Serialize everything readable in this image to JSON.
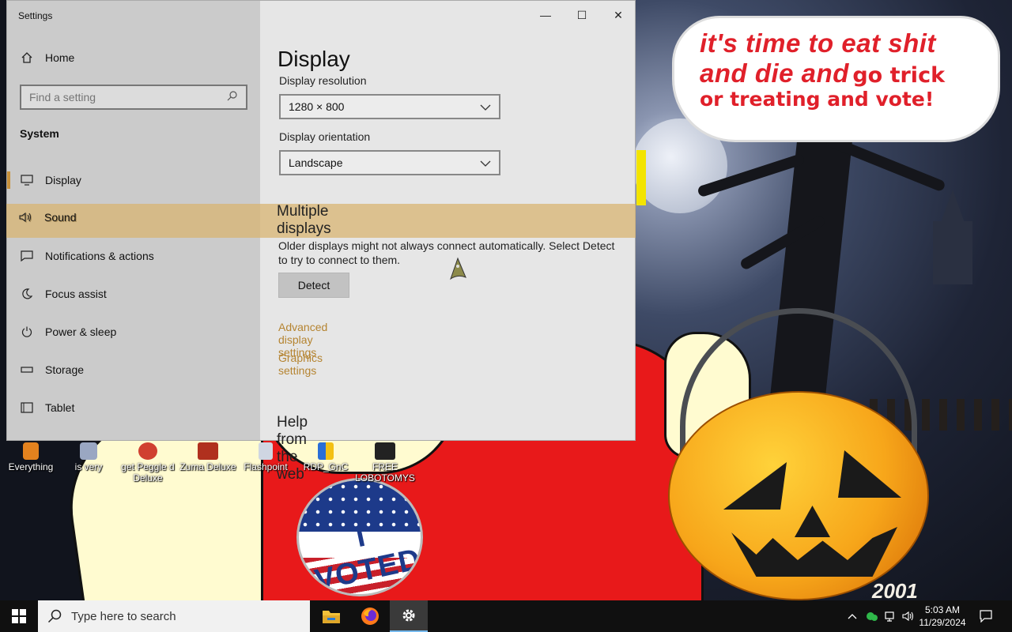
{
  "wallpaper": {
    "speech_line1": "it's time to eat shit",
    "speech_line2a": "and die and",
    "speech_line2b": "go trick",
    "speech_line3": "or treating and vote!",
    "badge_text": "I VOTED",
    "year_mark": "2001"
  },
  "desktop_icons": [
    {
      "label": "Everything"
    },
    {
      "label": "is very"
    },
    {
      "label": "get Peggle d Deluxe"
    },
    {
      "label": "Zuma Deluxe"
    },
    {
      "label": "Flashpoint"
    },
    {
      "label": "RDP_GnC"
    },
    {
      "label": "FREE LOBOTOMYS"
    }
  ],
  "settings": {
    "window_title": "Settings",
    "controls": {
      "minimize": "—",
      "maximize": "☐",
      "close": "✕"
    },
    "sidebar": {
      "home": "Home",
      "search_placeholder": "Find a setting",
      "section": "System",
      "items": [
        {
          "label": "Display",
          "icon": "monitor-icon"
        },
        {
          "label": "Sound",
          "icon": "speaker-icon"
        },
        {
          "label": "Notifications & actions",
          "icon": "message-icon"
        },
        {
          "label": "Focus assist",
          "icon": "moon-icon"
        },
        {
          "label": "Power & sleep",
          "icon": "power-icon"
        },
        {
          "label": "Storage",
          "icon": "drive-icon"
        },
        {
          "label": "Tablet",
          "icon": "tablet-icon"
        }
      ]
    },
    "main": {
      "title": "Display",
      "resolution_label": "Display resolution",
      "resolution_value": "1280 × 800",
      "orientation_label": "Display orientation",
      "orientation_value": "Landscape",
      "multiple_displays_title": "Multiple displays",
      "multiple_displays_text": "Older displays might not always connect automatically. Select Detect to try to connect to them.",
      "detect_button": "Detect",
      "advanced_link": "Advanced display settings",
      "graphics_link": "Graphics settings",
      "help_title": "Help from the web"
    },
    "colors": {
      "accent": "#b58431",
      "highlight": "#d8b36e"
    }
  },
  "taskbar": {
    "search_placeholder": "Type here to search",
    "apps": [
      "file-explorer-icon",
      "firefox-icon",
      "settings-gear-icon"
    ],
    "time": "5:03 AM",
    "date": "11/29/2024"
  }
}
